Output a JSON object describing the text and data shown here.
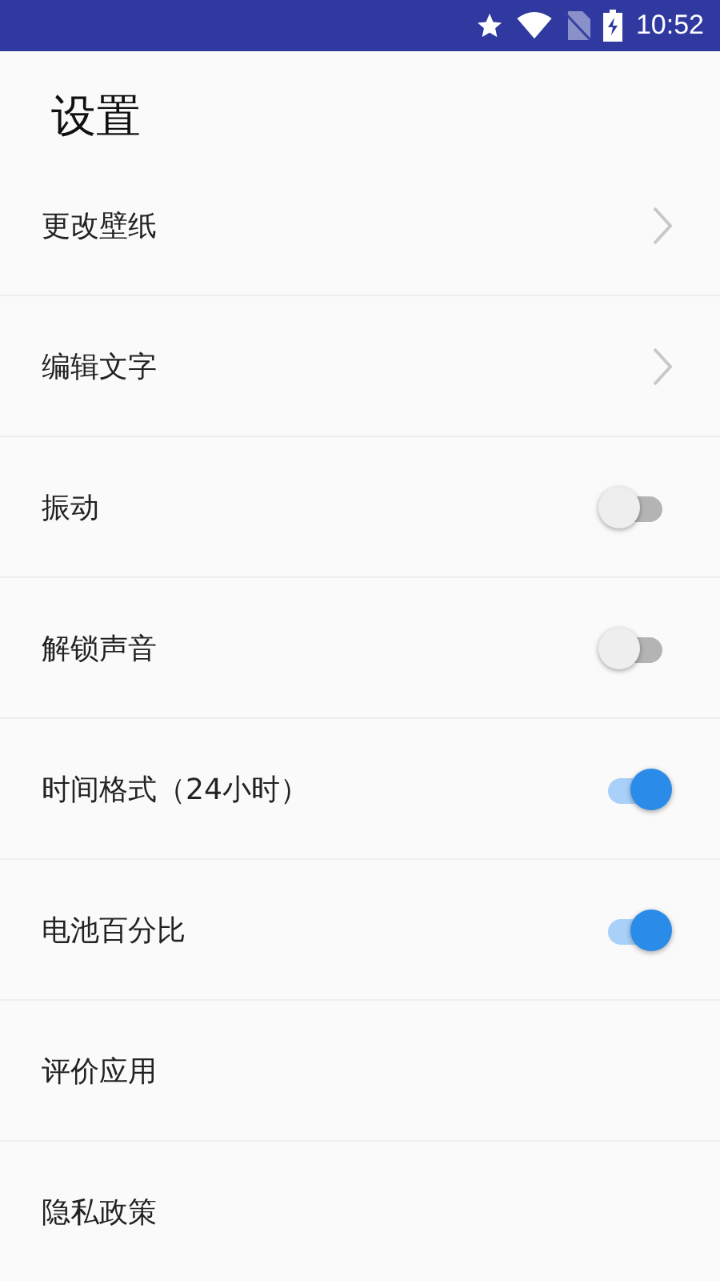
{
  "status_bar": {
    "time": "10:52"
  },
  "title": "设置",
  "items": [
    {
      "kind": "link",
      "label": "更改壁纸"
    },
    {
      "kind": "link",
      "label": "编辑文字"
    },
    {
      "kind": "toggle",
      "label": "振动",
      "on": false
    },
    {
      "kind": "toggle",
      "label": "解锁声音",
      "on": false
    },
    {
      "kind": "toggle",
      "label": "时间格式（24小时）",
      "on": true
    },
    {
      "kind": "toggle",
      "label": "电池百分比",
      "on": true
    },
    {
      "kind": "plain",
      "label": "评价应用"
    },
    {
      "kind": "plain",
      "label": "隐私政策"
    }
  ]
}
